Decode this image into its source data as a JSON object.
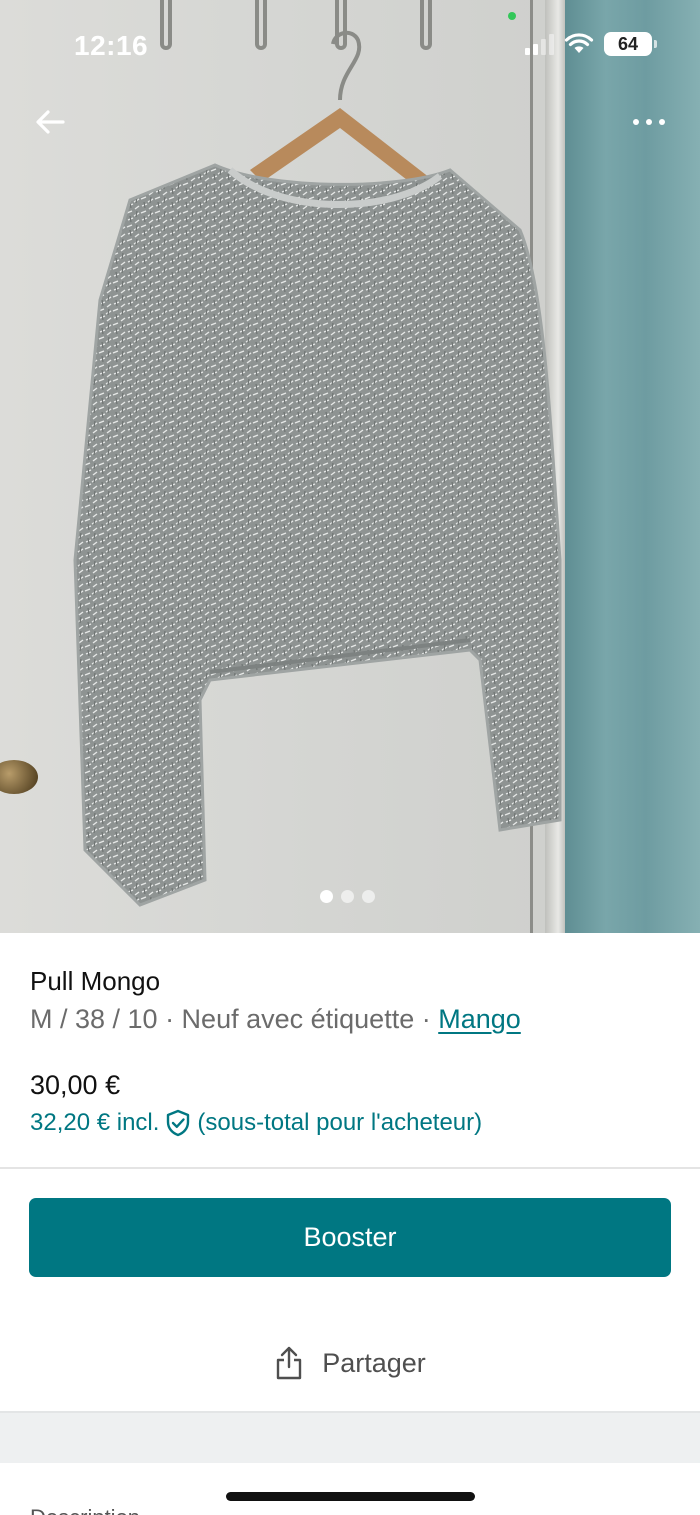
{
  "status_bar": {
    "time": "12:16",
    "battery": "64"
  },
  "gallery": {
    "image_count": 3,
    "active_index": 0
  },
  "item": {
    "title": "Pull Mongo",
    "meta_prefix": "M / 38 / 10 · Neuf avec étiquette · ",
    "brand": "Mango",
    "price": "30,00 €",
    "price_incl": "32,20 € incl.",
    "price_incl_note": "(sous-total pour l'acheteur)"
  },
  "actions": {
    "booster_label": "Booster",
    "share_label": "Partager"
  },
  "next_section": {
    "label": "Description"
  },
  "colors": {
    "accent": "#007782",
    "photo_door": "#6e9ca1"
  }
}
